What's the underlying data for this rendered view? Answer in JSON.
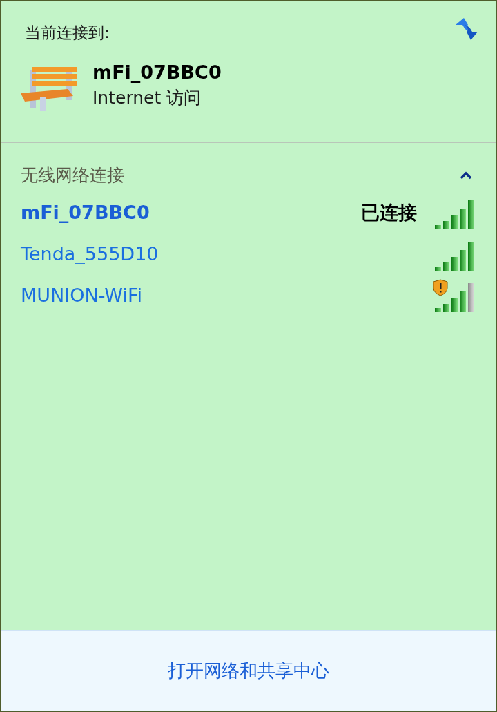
{
  "current": {
    "heading": "当前连接到:",
    "network": "mFi_07BBC0",
    "access": "Internet 访问"
  },
  "section": {
    "title": "无线网络连接",
    "expanded": true
  },
  "networks": [
    {
      "name": "mFi_07BBC0",
      "connected": true,
      "status": "已连接",
      "secured": false,
      "kind": "full"
    },
    {
      "name": "Tenda_555D10",
      "connected": false,
      "secured": false,
      "kind": "full"
    },
    {
      "name": "MUNION-WiFi",
      "connected": false,
      "secured": true,
      "kind": "partial"
    }
  ],
  "footer": {
    "link": "打开网络和共享中心"
  }
}
